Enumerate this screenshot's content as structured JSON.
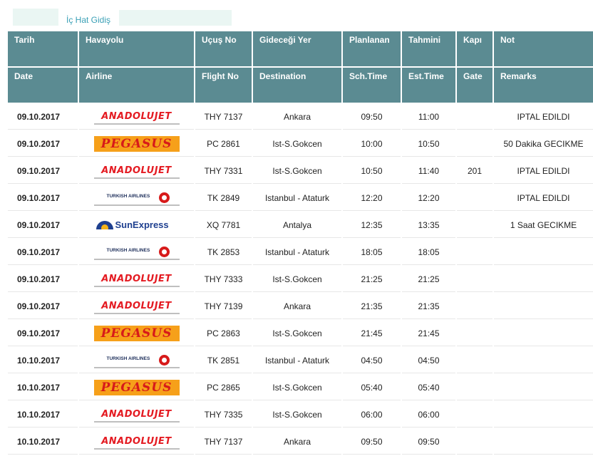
{
  "page": {
    "link_label": "İç Hat Gidiş"
  },
  "columns": {
    "tr": [
      "Tarih",
      "Havayolu",
      "Uçuş No",
      "Gideceği Yer",
      "Planlanan",
      "Tahmini",
      "Kapı",
      "Not"
    ],
    "en": [
      "Date",
      "Airline",
      "Flight No",
      "Destination",
      "Sch.Time",
      "Est.Time",
      "Gate",
      "Remarks"
    ]
  },
  "flights": [
    {
      "date": "09.10.2017",
      "airline": "anadolujet",
      "flight_no": "THY 7137",
      "destination": "Ankara",
      "sch_time": "09:50",
      "est_time": "11:00",
      "gate": "",
      "remarks": "IPTAL EDILDI"
    },
    {
      "date": "09.10.2017",
      "airline": "pegasus",
      "flight_no": "PC 2861",
      "destination": "Ist-S.Gokcen",
      "sch_time": "10:00",
      "est_time": "10:50",
      "gate": "",
      "remarks": "50 Dakika GECIKME"
    },
    {
      "date": "09.10.2017",
      "airline": "anadolujet",
      "flight_no": "THY 7331",
      "destination": "Ist-S.Gokcen",
      "sch_time": "10:50",
      "est_time": "11:40",
      "gate": "201",
      "remarks": "IPTAL EDILDI"
    },
    {
      "date": "09.10.2017",
      "airline": "turkish",
      "flight_no": "TK 2849",
      "destination": "Istanbul - Ataturk",
      "sch_time": "12:20",
      "est_time": "12:20",
      "gate": "",
      "remarks": "IPTAL EDILDI"
    },
    {
      "date": "09.10.2017",
      "airline": "sunexpress",
      "flight_no": "XQ 7781",
      "destination": "Antalya",
      "sch_time": "12:35",
      "est_time": "13:35",
      "gate": "",
      "remarks": "1 Saat GECIKME"
    },
    {
      "date": "09.10.2017",
      "airline": "turkish",
      "flight_no": "TK 2853",
      "destination": "Istanbul - Ataturk",
      "sch_time": "18:05",
      "est_time": "18:05",
      "gate": "",
      "remarks": ""
    },
    {
      "date": "09.10.2017",
      "airline": "anadolujet",
      "flight_no": "THY 7333",
      "destination": "Ist-S.Gokcen",
      "sch_time": "21:25",
      "est_time": "21:25",
      "gate": "",
      "remarks": ""
    },
    {
      "date": "09.10.2017",
      "airline": "anadolujet",
      "flight_no": "THY 7139",
      "destination": "Ankara",
      "sch_time": "21:35",
      "est_time": "21:35",
      "gate": "",
      "remarks": ""
    },
    {
      "date": "09.10.2017",
      "airline": "pegasus",
      "flight_no": "PC 2863",
      "destination": "Ist-S.Gokcen",
      "sch_time": "21:45",
      "est_time": "21:45",
      "gate": "",
      "remarks": ""
    },
    {
      "date": "10.10.2017",
      "airline": "turkish",
      "flight_no": "TK 2851",
      "destination": "Istanbul - Ataturk",
      "sch_time": "04:50",
      "est_time": "04:50",
      "gate": "",
      "remarks": ""
    },
    {
      "date": "10.10.2017",
      "airline": "pegasus",
      "flight_no": "PC 2865",
      "destination": "Ist-S.Gokcen",
      "sch_time": "05:40",
      "est_time": "05:40",
      "gate": "",
      "remarks": ""
    },
    {
      "date": "10.10.2017",
      "airline": "anadolujet",
      "flight_no": "THY 7335",
      "destination": "Ist-S.Gokcen",
      "sch_time": "06:00",
      "est_time": "06:00",
      "gate": "",
      "remarks": ""
    },
    {
      "date": "10.10.2017",
      "airline": "anadolujet",
      "flight_no": "THY 7137",
      "destination": "Ankara",
      "sch_time": "09:50",
      "est_time": "09:50",
      "gate": "",
      "remarks": ""
    }
  ],
  "logos": {
    "anadolujet": {
      "text_a": "ANADOLU",
      "text_b": "JET",
      "icon": "anadolujet-logo"
    },
    "pegasus": {
      "text": "PEGASUS",
      "icon": "pegasus-logo"
    },
    "turkish": {
      "text": "TURKISH AIRLINES",
      "icon": "turkish-airlines-logo"
    },
    "sunexpress": {
      "text": "SunExpress",
      "icon": "sunexpress-logo"
    }
  },
  "colors": {
    "header_bg": "#5b8b92",
    "link": "#3aa0b6",
    "anadolujet_red": "#e41b22",
    "pegasus_orange": "#f6a01a",
    "thy_navy": "#1d2e5a",
    "sunexpress_blue": "#1e3f8f"
  }
}
